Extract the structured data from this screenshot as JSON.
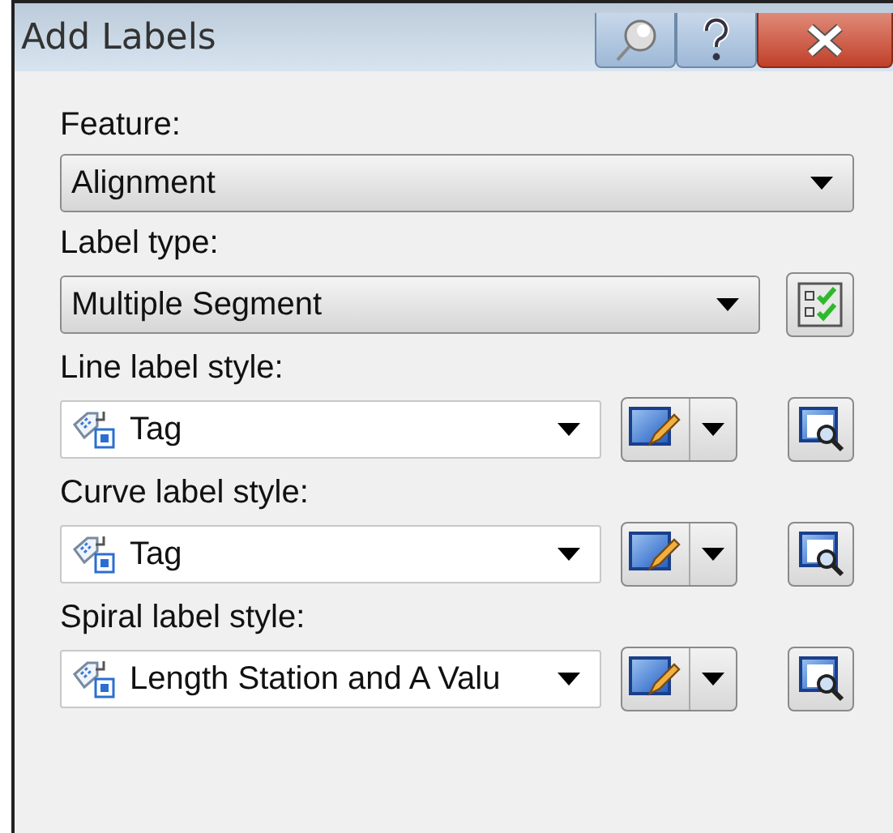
{
  "window": {
    "title": "Add Labels"
  },
  "fields": [
    {
      "kind": "plain",
      "label": "Feature:",
      "value": "Alignment"
    },
    {
      "kind": "type",
      "label": "Label type:",
      "value": "Multiple Segment"
    },
    {
      "kind": "style",
      "label": "Line label style:",
      "value": "Tag"
    },
    {
      "kind": "style",
      "label": "Curve label style:",
      "value": "Tag"
    },
    {
      "kind": "style",
      "label": "Spiral label style:",
      "value": "Length Station and A Valu"
    }
  ]
}
